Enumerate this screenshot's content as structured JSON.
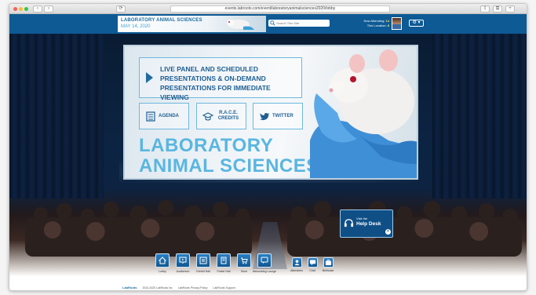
{
  "browser": {
    "url": "events.labroots.com/event/laboratoryanimalsciences2020/lobby",
    "tab_buttons": [
      "‹",
      "›",
      "⟳"
    ]
  },
  "header": {
    "brand_title": "LABORATORY ANIMAL SCIENCES",
    "brand_date": "MAY 14, 2020",
    "search_placeholder": "Search This Site",
    "now_attending_label": "Now Attending:",
    "now_attending_value": "14",
    "this_location_label": "This Location:",
    "this_location_value": "8",
    "gear_label": "⚙ ▾"
  },
  "banner": {
    "live_text": "LIVE PANEL AND SCHEDULED PRESENTATIONS & ON-DEMAND PRESENTATIONS FOR IMMEDIATE VIEWING",
    "agenda_label": "AGENDA",
    "race_label": "R.A.C.E. CREDITS",
    "twitter_label": "TWITTER",
    "title_line1": "LABORATORY",
    "title_line2": "ANIMAL SCIENCES"
  },
  "dock": {
    "items": [
      {
        "label": "Lobby",
        "icon": "home-icon"
      },
      {
        "label": "Auditorium",
        "icon": "auditorium-icon"
      },
      {
        "label": "Exhibit Hall",
        "icon": "exhibit-icon"
      },
      {
        "label": "Poster Hall",
        "icon": "poster-icon"
      },
      {
        "label": "Store",
        "icon": "cart-icon"
      },
      {
        "label": "Networking Lounge",
        "icon": "chat-icon"
      },
      {
        "label": "Attendees",
        "icon": "attendees-icon"
      },
      {
        "label": "Chat",
        "icon": "chat-bubble-icon"
      },
      {
        "label": "Briefcase",
        "icon": "briefcase-icon"
      }
    ]
  },
  "helpdesk": {
    "visit_label": "Visit the",
    "title": "Help Desk"
  },
  "footer": {
    "brand": "LabRoots",
    "copyright": "2010-2020 LabRoots Inc",
    "privacy": "LabRoots Privacy Policy",
    "support": "LabRoots Support"
  },
  "colors": {
    "header_blue": "#0d5a95",
    "title_blue": "#5ab6e0",
    "dock_blue": "#12578f"
  }
}
